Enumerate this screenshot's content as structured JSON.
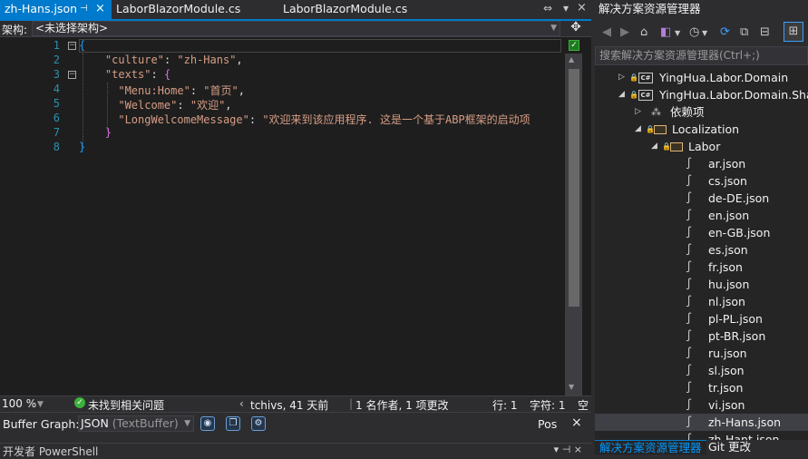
{
  "tabs": [
    {
      "label": "zh-Hans.json",
      "active": true,
      "pin": "⊣",
      "close": "×"
    },
    {
      "label": "LaborBlazorModule.cs",
      "active": false
    },
    {
      "label": "LaborBlazorModule.cs",
      "active": false
    }
  ],
  "tab_overflow": {
    "pin": "⇔",
    "dropdown": "▾"
  },
  "nav": {
    "label": "架构:",
    "value": "<未选择架构>"
  },
  "editor": {
    "line_numbers": [
      "1",
      "2",
      "3",
      "4",
      "5",
      "6",
      "7",
      "8"
    ],
    "lines": [
      {
        "indent": "",
        "parts": [
          [
            "brace-b",
            "{"
          ]
        ]
      },
      {
        "indent": "    ",
        "parts": [
          [
            "key",
            "\"culture\""
          ],
          [
            "punc",
            ": "
          ],
          [
            "str",
            "\"zh-Hans\""
          ],
          [
            "punc",
            ","
          ]
        ]
      },
      {
        "indent": "    ",
        "parts": [
          [
            "key",
            "\"texts\""
          ],
          [
            "punc",
            ": "
          ],
          [
            "brace-m",
            "{"
          ]
        ]
      },
      {
        "indent": "      ",
        "parts": [
          [
            "key",
            "\"Menu:Home\""
          ],
          [
            "punc",
            ": "
          ],
          [
            "str",
            "\"首页\""
          ],
          [
            "punc",
            ","
          ]
        ]
      },
      {
        "indent": "      ",
        "parts": [
          [
            "key",
            "\"Welcome\""
          ],
          [
            "punc",
            ": "
          ],
          [
            "str",
            "\"欢迎\""
          ],
          [
            "punc",
            ","
          ]
        ]
      },
      {
        "indent": "      ",
        "parts": [
          [
            "key",
            "\"LongWelcomeMessage\""
          ],
          [
            "punc",
            ": "
          ],
          [
            "str",
            "\"欢迎来到该应用程序. 这是一个基于ABP框架的启动项"
          ]
        ]
      },
      {
        "indent": "    ",
        "parts": [
          [
            "brace-m",
            "}"
          ]
        ]
      },
      {
        "indent": "",
        "parts": [
          [
            "brace-b",
            "}"
          ]
        ]
      }
    ]
  },
  "status": {
    "zoom": "100 %",
    "issues": "未找到相关问题",
    "git": "tchivs, 41 天前",
    "authors": "1 名作者, 1 项更改",
    "line": "行: 1",
    "char": "字符: 1",
    "space": "空"
  },
  "buffer_graph": {
    "label": "Buffer Graph:",
    "value": "JSON",
    "value_suffix": "(TextBuffer)",
    "pos": "Pos",
    "close": "×"
  },
  "bottom_panel": {
    "title": "开发者 PowerShell",
    "buttons": "▾ ⊣ ×"
  },
  "solution_explorer": {
    "title": "解决方案资源管理器",
    "search_placeholder": "搜索解决方案资源管理器(Ctrl+;)",
    "tree": [
      {
        "label": "YingHua.Labor.Domain",
        "type": "project",
        "level": 0,
        "expanded": false
      },
      {
        "label": "YingHua.Labor.Domain.Shared",
        "type": "project",
        "level": 0,
        "expanded": true
      },
      {
        "label": "依赖项",
        "type": "deps",
        "level": 1,
        "expanded": false
      },
      {
        "label": "Localization",
        "type": "folder",
        "level": 1,
        "expanded": true
      },
      {
        "label": "Labor",
        "type": "folder",
        "level": 2,
        "expanded": true
      },
      {
        "label": "ar.json",
        "type": "json",
        "level": 3
      },
      {
        "label": "cs.json",
        "type": "json",
        "level": 3
      },
      {
        "label": "de-DE.json",
        "type": "json",
        "level": 3
      },
      {
        "label": "en.json",
        "type": "json",
        "level": 3
      },
      {
        "label": "en-GB.json",
        "type": "json",
        "level": 3
      },
      {
        "label": "es.json",
        "type": "json",
        "level": 3
      },
      {
        "label": "fr.json",
        "type": "json",
        "level": 3
      },
      {
        "label": "hu.json",
        "type": "json",
        "level": 3
      },
      {
        "label": "nl.json",
        "type": "json",
        "level": 3
      },
      {
        "label": "pl-PL.json",
        "type": "json",
        "level": 3
      },
      {
        "label": "pt-BR.json",
        "type": "json",
        "level": 3
      },
      {
        "label": "ru.json",
        "type": "json",
        "level": 3
      },
      {
        "label": "sl.json",
        "type": "json",
        "level": 3
      },
      {
        "label": "tr.json",
        "type": "json",
        "level": 3
      },
      {
        "label": "vi.json",
        "type": "json",
        "level": 3
      },
      {
        "label": "zh-Hans.json",
        "type": "json",
        "level": 3,
        "selected": true
      },
      {
        "label": "zh-Hant.json",
        "type": "json",
        "level": 3
      }
    ],
    "bottom_tabs": [
      "解决方案资源管理器",
      "Git 更改"
    ]
  }
}
